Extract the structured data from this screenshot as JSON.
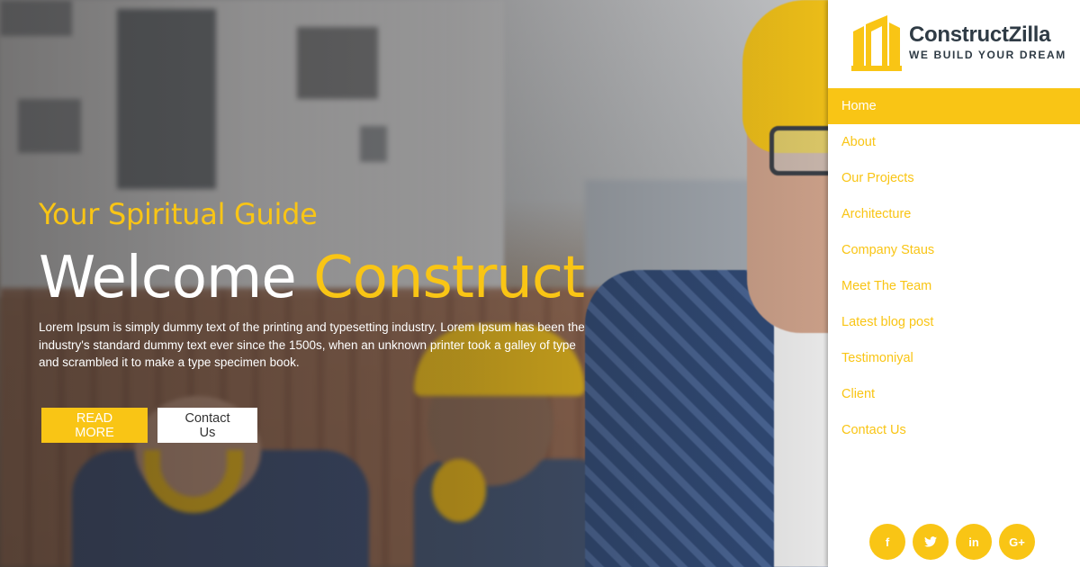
{
  "hero": {
    "tagline": "Your Spiritual Guide",
    "headline_white": "Welcome",
    "headline_accent": "Construct",
    "description": "Lorem Ipsum is simply dummy text of the printing and typesetting industry. Lorem Ipsum has been the industry's standard dummy text ever since the 1500s, when an unknown printer took a galley of type and scrambled it to make a type specimen book.",
    "read_more_label": "READ MORE",
    "contact_label": "Contact Us"
  },
  "brand": {
    "name": "ConstructZilla",
    "slogan": "WE BUILD YOUR DREAM",
    "accent_color": "#f9c515",
    "dark_color": "#2f3b45"
  },
  "sidebar": {
    "items": [
      {
        "label": "Home",
        "active": true
      },
      {
        "label": "About",
        "active": false
      },
      {
        "label": "Our Projects",
        "active": false
      },
      {
        "label": "Architecture",
        "active": false
      },
      {
        "label": "Company Staus",
        "active": false
      },
      {
        "label": "Meet The Team",
        "active": false
      },
      {
        "label": "Latest blog post",
        "active": false
      },
      {
        "label": "Testimoniyal",
        "active": false
      },
      {
        "label": "Client",
        "active": false
      },
      {
        "label": "Contact Us",
        "active": false
      }
    ]
  },
  "social": {
    "facebook": "f",
    "twitter": "twitter-bird",
    "linkedin": "in",
    "googleplus": "G+"
  }
}
